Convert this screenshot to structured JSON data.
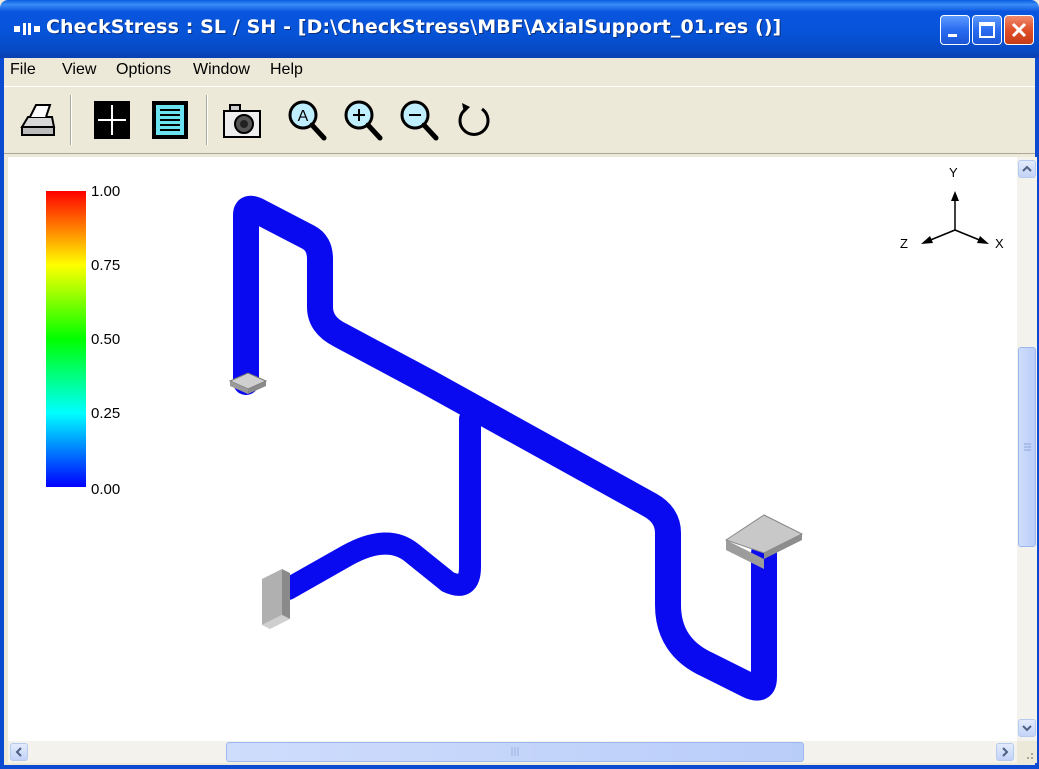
{
  "window": {
    "title": "CheckStress : SL / SH -  [D:\\CheckStress\\MBF\\AxialSupport_01.res ()]"
  },
  "menu": {
    "items": [
      "File",
      "View",
      "Options",
      "Window",
      "Help"
    ]
  },
  "toolbar": {
    "buttons": [
      "print-icon",
      "crosshair-icon",
      "document-list-icon",
      "camera-icon",
      "zoom-auto-icon",
      "zoom-in-icon",
      "zoom-out-icon",
      "rotate-icon"
    ]
  },
  "legend": {
    "ticks": [
      "1.00",
      "0.75",
      "0.50",
      "0.25",
      "0.00"
    ],
    "colors": [
      "#ff0000",
      "#ffff00",
      "#00ff00",
      "#00ffff",
      "#0000ff"
    ]
  },
  "axes": {
    "x": "X",
    "y": "Y",
    "z": "Z"
  },
  "pipe": {
    "color": "#0a0af0"
  },
  "scrollbar": {
    "grip": "|||"
  }
}
